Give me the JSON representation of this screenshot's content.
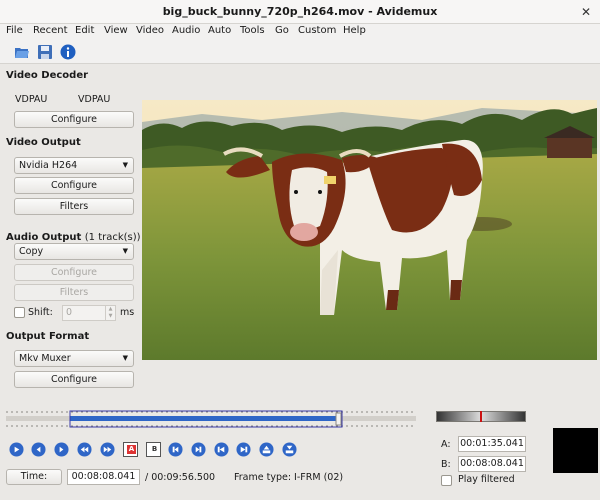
{
  "window": {
    "title": "big_buck_bunny_720p_h264.mov - Avidemux"
  },
  "menu": [
    "File",
    "Recent",
    "Edit",
    "View",
    "Video",
    "Audio",
    "Auto",
    "Tools",
    "Go",
    "Custom",
    "Help"
  ],
  "toolbar": {
    "icons": [
      "open-folder-icon",
      "save-disk-icon",
      "info-icon"
    ]
  },
  "video_decoder": {
    "title": "Video Decoder",
    "left_label": "VDPAU",
    "right_label": "VDPAU",
    "configure": "Configure"
  },
  "video_output": {
    "title": "Video Output",
    "codec": "Nvidia H264",
    "configure": "Configure",
    "filters": "Filters"
  },
  "audio_output": {
    "title": "Audio Output",
    "tracks": "(1 track(s))",
    "codec": "Copy",
    "configure": "Configure",
    "filters": "Filters",
    "shift_label": "Shift:",
    "shift_value": "0",
    "shift_unit": "ms"
  },
  "output_format": {
    "title": "Output Format",
    "muxer": "Mkv Muxer",
    "configure": "Configure"
  },
  "playback_controls": [
    "play-icon",
    "rewind-icon",
    "forward-icon",
    "prev-keyframe-icon",
    "next-keyframe-icon",
    "set-marker-a-icon",
    "set-marker-b-icon",
    "prev-black-icon",
    "next-black-icon",
    "first-frame-icon",
    "last-frame-icon",
    "goto-a-icon",
    "goto-b-icon"
  ],
  "marker_a_label": "A",
  "marker_b_label": "B",
  "status": {
    "time_label": "Time:",
    "current_time": "00:08:08.041",
    "total_time": "/ 00:09:56.500",
    "frame_type": "Frame type:  I-FRM (02)"
  },
  "selection": {
    "a_label": "A:",
    "a_value": "00:01:35.041",
    "b_label": "B:",
    "b_value": "00:08:08.041",
    "play_filtered": "Play filtered"
  },
  "colors": {
    "accent": "#2f66c7",
    "selection_border": "#3a3aa8",
    "sky": "#f4e8c8",
    "grass": "#7d9a3d",
    "cow_brown": "#7a2d14"
  }
}
